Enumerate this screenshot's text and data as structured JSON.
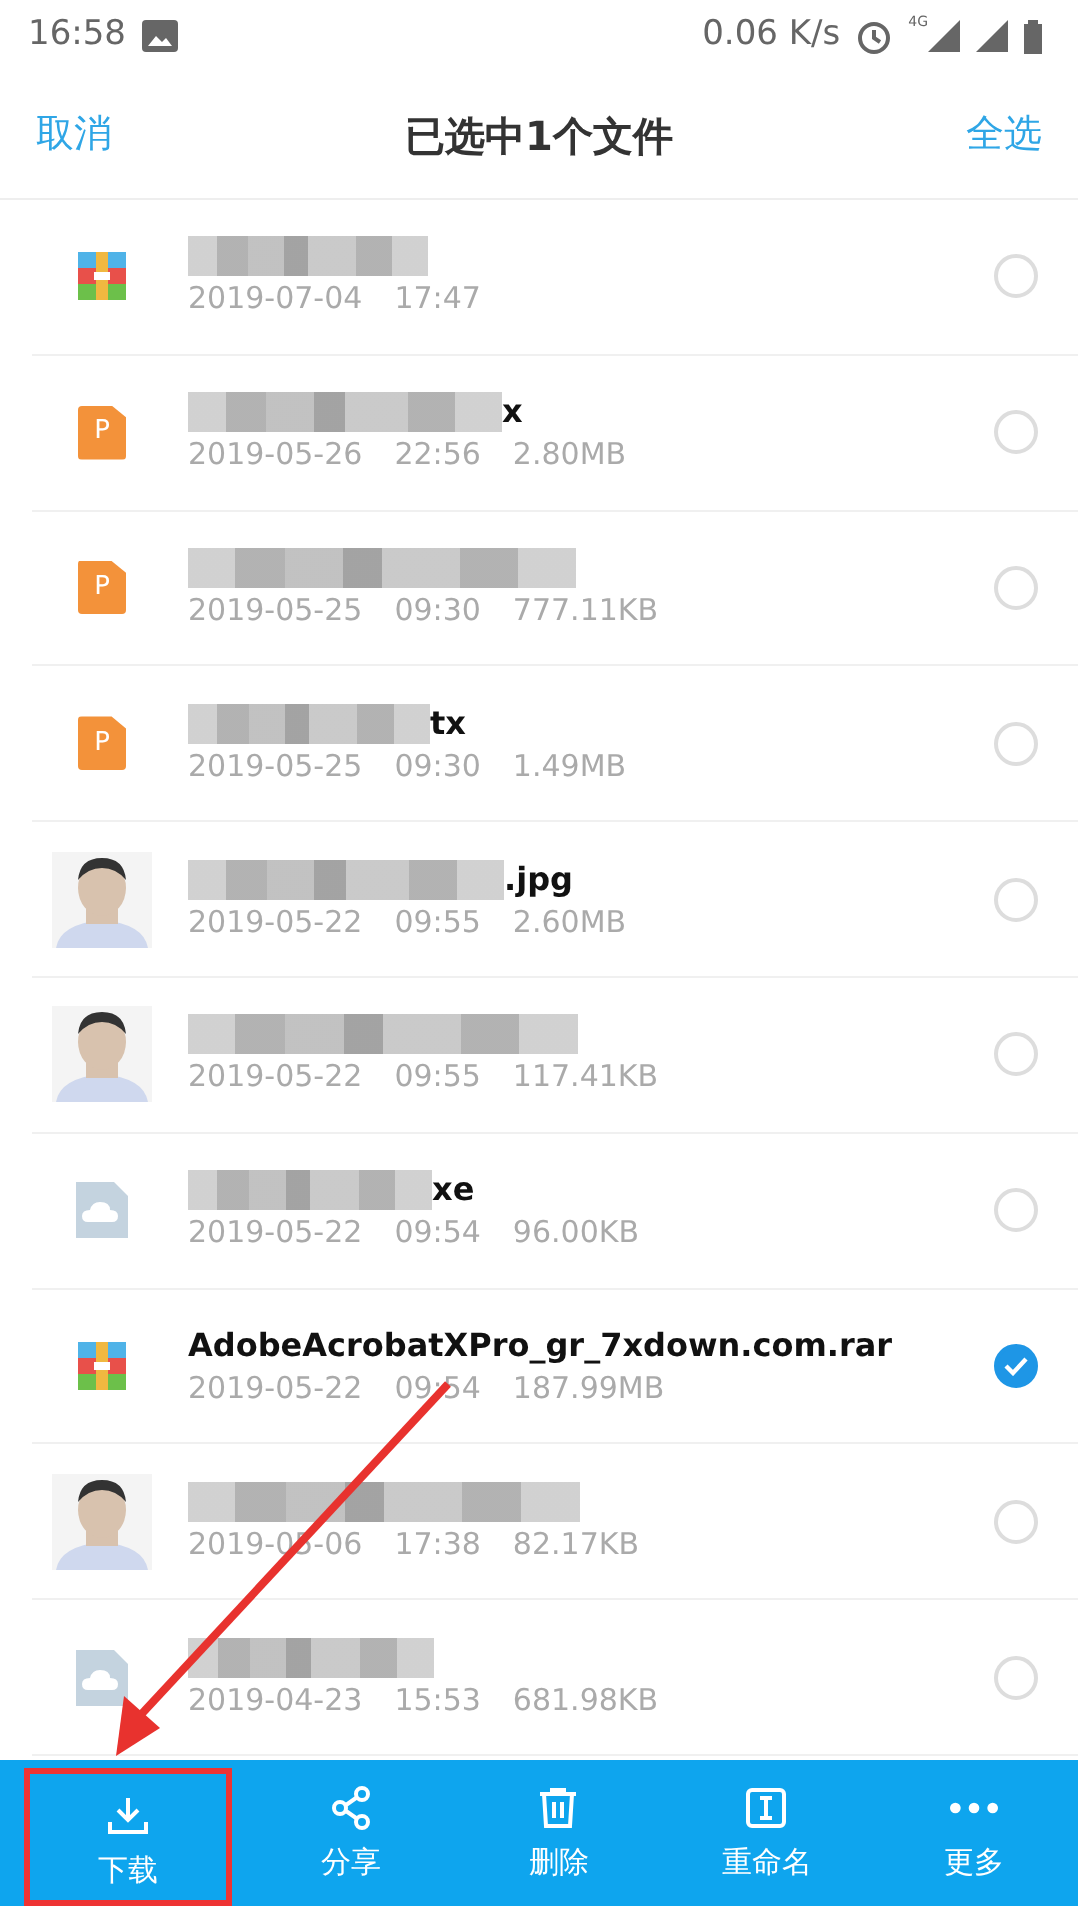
{
  "status_bar": {
    "time": "16:58",
    "speed": "0.06 K/s",
    "network": "4G"
  },
  "header": {
    "cancel": "取消",
    "title": "已选中1个文件",
    "select_all": "全选"
  },
  "files": [
    {
      "kind": "archive",
      "blurred": true,
      "date": "2019-07-04",
      "time": "17:47",
      "selected": false
    },
    {
      "kind": "ppt",
      "badge": "P",
      "blurred": true,
      "name_end": "x",
      "date": "2019-05-26",
      "time": "22:56",
      "size": "2.80MB",
      "selected": false
    },
    {
      "kind": "ppt",
      "badge": "P",
      "blurred": true,
      "date": "2019-05-25",
      "time": "09:30",
      "size": "777.11KB",
      "selected": false
    },
    {
      "kind": "ppt",
      "badge": "P",
      "blurred": true,
      "name_end": "tx",
      "date": "2019-05-25",
      "time": "09:30",
      "size": "1.49MB",
      "selected": false
    },
    {
      "kind": "photo",
      "blurred": true,
      "name_end": ".jpg",
      "date": "2019-05-22",
      "time": "09:55",
      "size": "2.60MB",
      "selected": false
    },
    {
      "kind": "photo",
      "blurred": true,
      "date": "2019-05-22",
      "time": "09:55",
      "size": "117.41KB",
      "selected": false
    },
    {
      "kind": "cloud",
      "blurred": true,
      "name_end": "xe",
      "date": "2019-05-22",
      "time": "09:54",
      "size": "96.00KB",
      "selected": false
    },
    {
      "kind": "archive",
      "blurred": false,
      "name_end": "AdobeAcrobatXPro_gr_7xdown.com.rar",
      "date": "2019-05-22",
      "time": "09:54",
      "size": "187.99MB",
      "selected": true
    },
    {
      "kind": "photo",
      "blurred": true,
      "date": "2019-05-06",
      "time": "17:38",
      "size": "82.17KB",
      "selected": false
    },
    {
      "kind": "cloud",
      "blurred": true,
      "date": "2019-04-23",
      "time": "15:53",
      "size": "681.98KB",
      "selected": false
    }
  ],
  "actions": [
    {
      "kind": "download",
      "label": "下载",
      "highlighted": true
    },
    {
      "kind": "share",
      "label": "分享",
      "highlighted": false
    },
    {
      "kind": "delete",
      "label": "删除",
      "highlighted": false
    },
    {
      "kind": "rename",
      "label": "重命名",
      "highlighted": false
    },
    {
      "kind": "more",
      "label": "更多",
      "highlighted": false
    }
  ]
}
